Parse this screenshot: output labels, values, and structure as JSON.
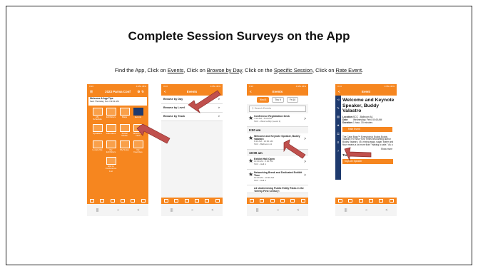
{
  "slide": {
    "title": "Complete Session Surveys on the App",
    "instruction": {
      "p1": "Find the App, Click on ",
      "l1": "Events",
      "p2": ", Click on ",
      "l2": "Browse by Day",
      "p3": ", Click on the ",
      "l3": "Specific Session",
      "p4": ", Click on ",
      "l4": "Rate Event",
      "p5": "."
    }
  },
  "status_time": "3:13",
  "status_time4": "3:14",
  "status_right": "4:95L 46%",
  "phone1": {
    "header": "2023 Parma Conf",
    "welcome_title": "Welcome & App Tips",
    "welcome_sub": "Sent Thursday, Nov 3 9:01 AM",
    "tiles": [
      "My Schedule",
      "Exhibitors",
      "Maps",
      "Events",
      "Speakers",
      "Attendees",
      "Social Media",
      "What's On Now",
      "Locate Me",
      "My Exhibitors",
      "My Notes",
      "My Favorites",
      "Exit to Conference List"
    ]
  },
  "phone2": {
    "header": "Events",
    "items": [
      "Browse by Day",
      "Browse by Level",
      "Browse by Track"
    ]
  },
  "phone3": {
    "header": "Events",
    "tabs": [
      "Wed 8",
      "Thu 9",
      "Fri 10"
    ],
    "search": "Search Events",
    "ev1_title": "Conference Registration Desk",
    "ev1_time": "7:00 AM - 5:00 PM",
    "ev1_loc": "SCC - West Lobby (Level 1)",
    "time1": "8:00 am",
    "ev2_title": "Welcome and Keynote Speaker, Buddy Valastro",
    "ev2_time": "8:40 AM - 10:00 AM",
    "ev2_loc": "SCC - Ballroom A1",
    "time2": "10:00 am",
    "ev3_title": "Exhibit Hall Open",
    "ev3_time": "10:00 AM - 5:00 PM",
    "ev3_loc": "SCC - Hall A",
    "ev4_title": "Networking Break and Dedicated Exhibit Time",
    "ev4_time": "10:00 AM - 10:30 AM",
    "ev4_loc": "SCC - Hall A",
    "ev5_title": "A1 Undermining Public Entity Risks in the Twenty-First Century:"
  },
  "phone4": {
    "header": "Event",
    "title": "Welcome and Keynote Speaker, Buddy Valastro",
    "location_label": "Location:",
    "location": "SCC - Ballroom A1",
    "date_label": "Date:",
    "date": "Wednesday, Feb 8 8:45 AM",
    "duration_label": "Duration:",
    "duration": "1 hour, 15 minutes",
    "rate_button": "Rate Event",
    "description": "The Cake Boss™ Everybody's Buddy Buddy Valastro For New York Times best-selling author Buddy Valastro, 45, mixing eggs, sugar, butter and flour means a lot more than \"making a cake.\" As a",
    "show_more": "Show more",
    "tracks_label": "Tracks",
    "track": "Keynote Speaker"
  },
  "colors": {
    "accent": "#f6861f",
    "navy": "#1e3a6e",
    "arrow": "#c0504d"
  }
}
